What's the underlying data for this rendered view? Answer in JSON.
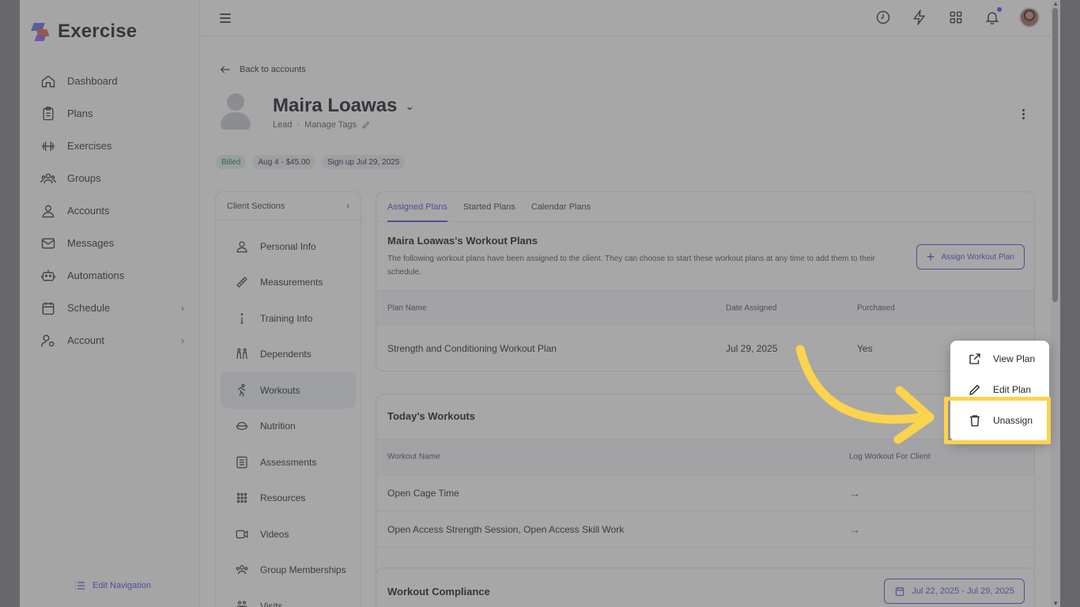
{
  "app": {
    "name": "Exercise"
  },
  "sidebar": {
    "items": [
      {
        "label": "Dashboard",
        "icon": "home-icon"
      },
      {
        "label": "Plans",
        "icon": "clipboard-icon"
      },
      {
        "label": "Exercises",
        "icon": "dumbbell-icon"
      },
      {
        "label": "Groups",
        "icon": "group-icon"
      },
      {
        "label": "Accounts",
        "icon": "user-icon"
      },
      {
        "label": "Messages",
        "icon": "mail-icon"
      },
      {
        "label": "Automations",
        "icon": "robot-icon"
      },
      {
        "label": "Schedule",
        "icon": "calendar-icon",
        "has_submenu": true
      },
      {
        "label": "Account",
        "icon": "user-gear-icon",
        "has_submenu": true
      }
    ],
    "edit_navigation": "Edit Navigation"
  },
  "header": {
    "icons": [
      "clock-icon",
      "lightning-icon",
      "grid-icon",
      "bell-icon",
      "avatar"
    ]
  },
  "back_link": "Back to accounts",
  "client": {
    "name": "Maira Loawas",
    "status": "Lead",
    "separator": "·",
    "manage_tags": "Manage Tags",
    "badges": [
      "Billed",
      "Aug 4 - $45.00",
      "Sign up Jul 29, 2025"
    ]
  },
  "client_sections": {
    "title": "Client Sections",
    "items": [
      {
        "label": "Personal Info",
        "icon": "person-icon"
      },
      {
        "label": "Measurements",
        "icon": "ruler-icon"
      },
      {
        "label": "Training Info",
        "icon": "info-icon"
      },
      {
        "label": "Dependents",
        "icon": "family-icon"
      },
      {
        "label": "Workouts",
        "icon": "running-icon",
        "active": true
      },
      {
        "label": "Nutrition",
        "icon": "bowl-icon"
      },
      {
        "label": "Assessments",
        "icon": "checklist-icon"
      },
      {
        "label": "Resources",
        "icon": "grid-dots-icon"
      },
      {
        "label": "Videos",
        "icon": "video-icon"
      },
      {
        "label": "Group Memberships",
        "icon": "group-icon"
      },
      {
        "label": "Visits",
        "icon": "visits-icon"
      }
    ]
  },
  "plans_card": {
    "tabs": [
      "Assigned Plans",
      "Started Plans",
      "Calendar Plans"
    ],
    "active_tab": "Assigned Plans",
    "title": "Maira Loawas's Workout Plans",
    "description": "The following workout plans have been assigned to the client. They can choose to start these workout plans at any time to add them to their schedule.",
    "assign_button": "Assign Workout Plan",
    "columns": [
      "Plan Name",
      "Date Assigned",
      "Purchased"
    ],
    "rows": [
      {
        "plan_name": "Strength and Conditioning Workout Plan",
        "date_assigned": "Jul 29, 2025",
        "purchased": "Yes"
      }
    ]
  },
  "today_card": {
    "title": "Today's Workouts",
    "columns": [
      "Workout Name",
      "Log Workout For Client"
    ],
    "rows": [
      {
        "name": "Open Cage Time",
        "action": "→"
      },
      {
        "name": "Open Access Strength Session, Open Access Skill Work",
        "action": "→"
      }
    ]
  },
  "compliance_card": {
    "title": "Workout Compliance",
    "date_range": "Jul 22, 2025 - Jul 29, 2025"
  },
  "context_menu": {
    "items": [
      {
        "label": "View Plan",
        "icon": "external-link-icon"
      },
      {
        "label": "Edit Plan",
        "icon": "pencil-icon"
      },
      {
        "label": "Unassign",
        "icon": "trash-icon",
        "highlighted": true
      }
    ]
  },
  "colors": {
    "accent": "#4b4fd6",
    "highlight": "#fcd34d",
    "billed_bg": "#dff2e7"
  }
}
